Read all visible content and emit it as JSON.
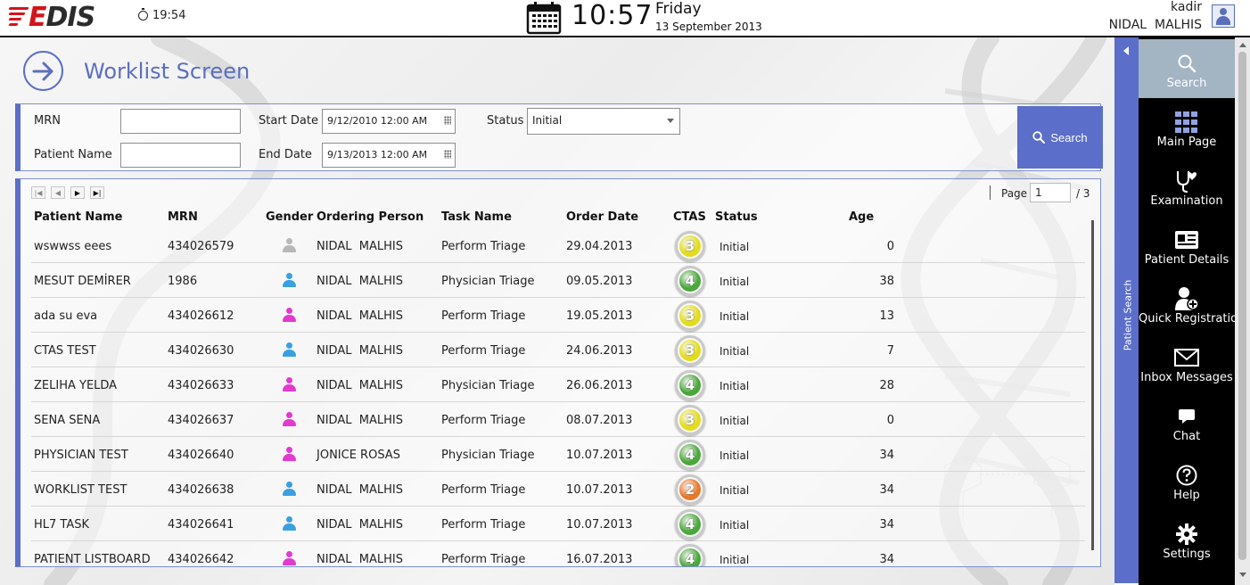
{
  "header": {
    "logo": "EDIS",
    "session_time": "19:54",
    "clock": "10:57",
    "day": "Friday",
    "date": "13 September 2013",
    "user_login": "kadir",
    "user_name": "NIDAL  MALHIS"
  },
  "page": {
    "title": "Worklist Screen"
  },
  "filters": {
    "mrn_label": "MRN",
    "mrn_value": "",
    "patient_name_label": "Patient Name",
    "patient_name_value": "",
    "start_date_label": "Start Date",
    "start_date_value": "9/12/2010 12:00 AM",
    "end_date_label": "End Date",
    "end_date_value": "9/13/2013 12:00 AM",
    "status_label": "Status",
    "status_value": "Initial",
    "search_button": "Search"
  },
  "pager": {
    "page_label": "Page",
    "current_page": "1",
    "total": "/ 3"
  },
  "table": {
    "columns": [
      "Patient Name",
      "MRN",
      "Gender",
      "Ordering Person",
      "Task Name",
      "Order Date",
      "CTAS",
      "Status",
      "Age"
    ],
    "rows": [
      {
        "name": "wswwss eees",
        "mrn": "434026579",
        "gender": "unknown",
        "ordering": "NIDAL  MALHIS",
        "task": "Perform Triage",
        "date": "29.04.2013",
        "ctas": "3",
        "status": "Initial",
        "age": "0"
      },
      {
        "name": "MESUT DEMİRER",
        "mrn": "1986",
        "gender": "male",
        "ordering": "NIDAL  MALHIS",
        "task": "Physician Triage",
        "date": "09.05.2013",
        "ctas": "4",
        "status": "Initial",
        "age": "38"
      },
      {
        "name": "ada su eva",
        "mrn": "434026612",
        "gender": "female",
        "ordering": "NIDAL  MALHIS",
        "task": "Perform Triage",
        "date": "19.05.2013",
        "ctas": "3",
        "status": "Initial",
        "age": "13"
      },
      {
        "name": "CTAS TEST",
        "mrn": "434026630",
        "gender": "male",
        "ordering": "NIDAL  MALHIS",
        "task": "Perform Triage",
        "date": "24.06.2013",
        "ctas": "3",
        "status": "Initial",
        "age": "7"
      },
      {
        "name": "ZELIHA YELDA",
        "mrn": "434026633",
        "gender": "female",
        "ordering": "NIDAL  MALHIS",
        "task": "Physician Triage",
        "date": "26.06.2013",
        "ctas": "4",
        "status": "Initial",
        "age": "28"
      },
      {
        "name": "SENA SENA",
        "mrn": "434026637",
        "gender": "female",
        "ordering": "NIDAL  MALHIS",
        "task": "Perform Triage",
        "date": "08.07.2013",
        "ctas": "3",
        "status": "Initial",
        "age": "0"
      },
      {
        "name": "PHYSICIAN TEST",
        "mrn": "434026640",
        "gender": "female",
        "ordering": "JONICE ROSAS",
        "task": "Physician Triage",
        "date": "10.07.2013",
        "ctas": "4",
        "status": "Initial",
        "age": "34"
      },
      {
        "name": "WORKLIST TEST",
        "mrn": "434026638",
        "gender": "male",
        "ordering": "NIDAL  MALHIS",
        "task": "Perform Triage",
        "date": "10.07.2013",
        "ctas": "2",
        "status": "Initial",
        "age": "34"
      },
      {
        "name": "HL7 TASK",
        "mrn": "434026641",
        "gender": "male",
        "ordering": "NIDAL  MALHIS",
        "task": "Perform Triage",
        "date": "10.07.2013",
        "ctas": "4",
        "status": "Initial",
        "age": "34"
      },
      {
        "name": "PATIENT LISTBOARD",
        "mrn": "434026642",
        "gender": "female",
        "ordering": "NIDAL  MALHIS",
        "task": "Perform Triage",
        "date": "16.07.2013",
        "ctas": "4",
        "status": "Initial",
        "age": "34"
      }
    ]
  },
  "side_panel": {
    "label": "Patient Search"
  },
  "menu": {
    "items": [
      {
        "label": "Search",
        "icon": "search-icon",
        "active": true
      },
      {
        "label": "Main Page",
        "icon": "grid-icon",
        "active": false
      },
      {
        "label": "Examination",
        "icon": "stethoscope-icon",
        "active": false
      },
      {
        "label": "Patient Details",
        "icon": "id-card-icon",
        "active": false
      },
      {
        "label": "Quick Registration",
        "icon": "add-user-icon",
        "active": false
      },
      {
        "label": "Inbox Messages",
        "icon": "envelope-icon",
        "active": false
      },
      {
        "label": "Chat",
        "icon": "chat-icon",
        "active": false
      },
      {
        "label": "Help",
        "icon": "help-icon",
        "active": false
      },
      {
        "label": "Settings",
        "icon": "gear-icon",
        "active": false
      }
    ]
  },
  "colors": {
    "accent": "#5b6ec9",
    "brand_red": "#d4141c",
    "menu_bg": "#000000",
    "menu_active": "#a3b4c3",
    "gender_male": "#3aa0e0",
    "gender_female": "#e23ad0",
    "gender_unknown": "#b8b8b8",
    "ctas_2": "#e8782a",
    "ctas_3": "#e3dc1c",
    "ctas_4": "#4aa83a"
  }
}
